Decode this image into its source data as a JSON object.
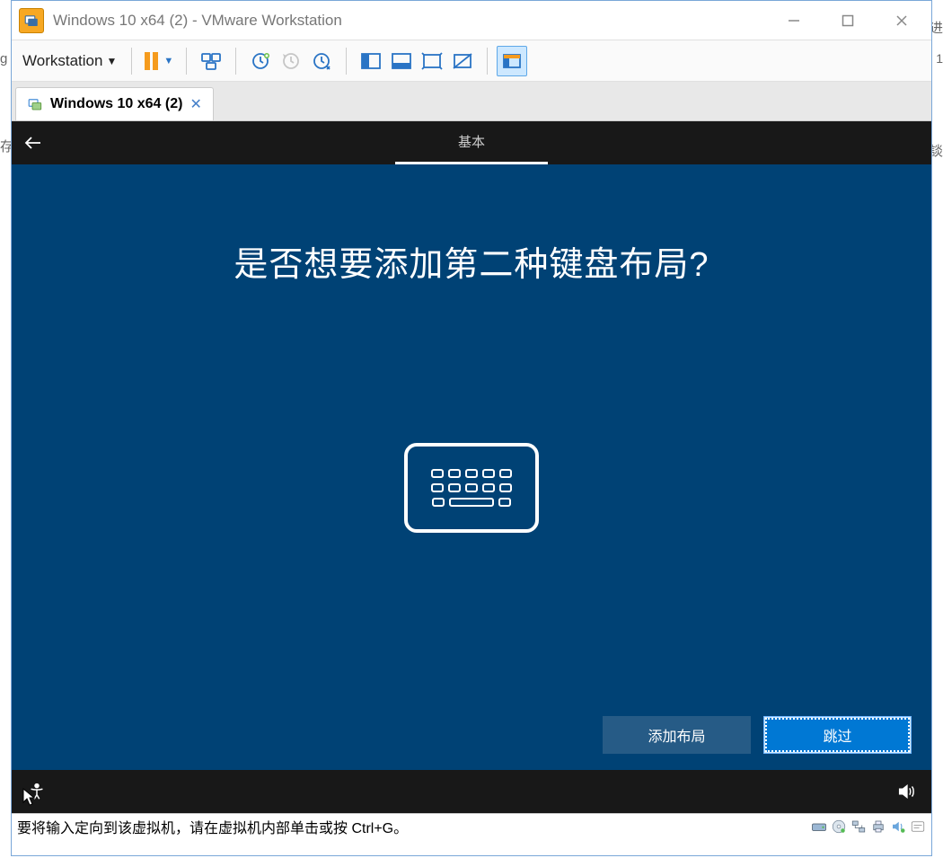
{
  "window": {
    "title": "Windows 10 x64 (2) - VMware Workstation"
  },
  "toolbar": {
    "menu_label": "Workstation"
  },
  "tab": {
    "label": "Windows 10 x64 (2)"
  },
  "oobe": {
    "back_icon": "back-arrow-icon",
    "tab_basic": "基本",
    "heading": "是否想要添加第二种键盘布局?",
    "keyboard_icon": "keyboard-outline-icon",
    "btn_add": "添加布局",
    "btn_skip": "跳过",
    "ease_icon": "ease-of-access-icon",
    "volume_icon": "volume-icon"
  },
  "statusbar": {
    "hint": "要将输入定向到该虚拟机，请在虚拟机内部单击或按 Ctrl+G。"
  },
  "edges": {
    "left1": "存",
    "left2": "g",
    "right1": "进",
    "right2": "1",
    "right3": "談"
  },
  "tray_icons": [
    "disk-icon",
    "cd-icon",
    "network-icon",
    "printer-icon",
    "sound-icon",
    "tools-icon"
  ]
}
